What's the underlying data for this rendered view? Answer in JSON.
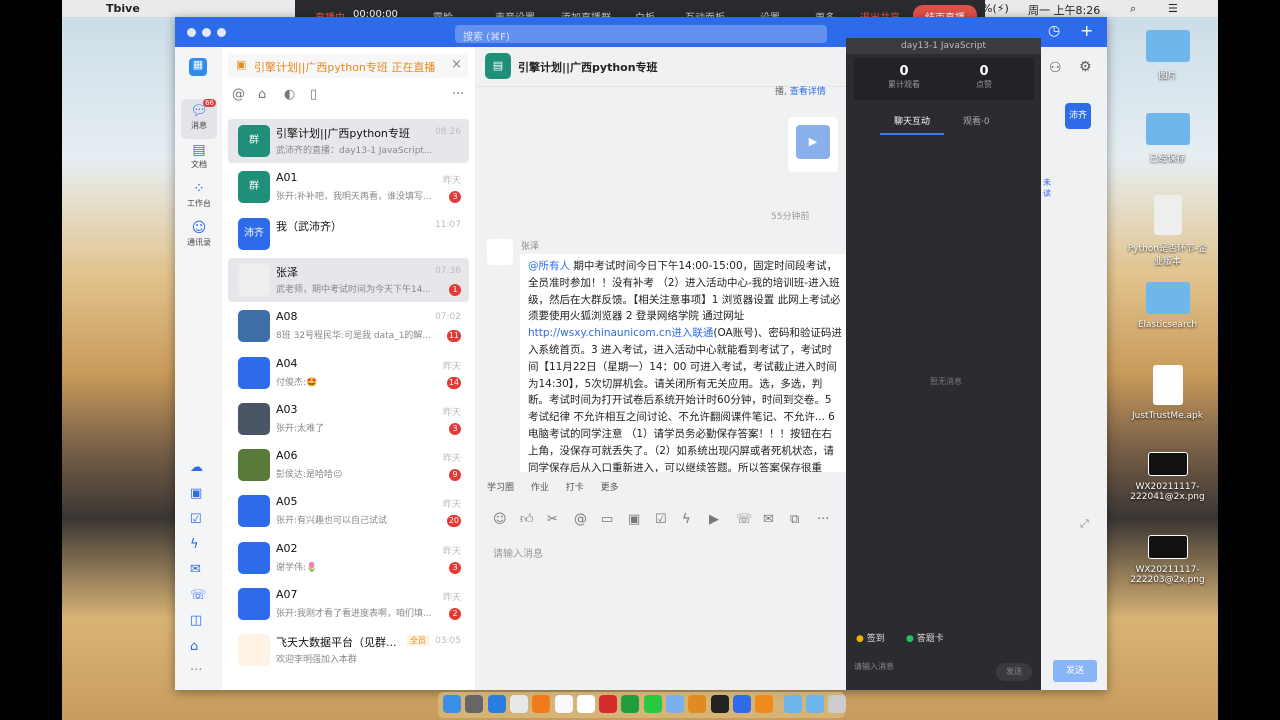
{
  "menubar": {
    "app": "Tbive",
    "status": "%(⚡)",
    "clock": "周一 上午8:26"
  },
  "livebar": {
    "live": "直播中",
    "timer": "00:00:00",
    "items": [
      "露脸",
      "声音设置",
      "添加直播群",
      "白板",
      "互动面板",
      "设置",
      "更多"
    ],
    "stop_share": "退出共享",
    "end_live": "结束直播"
  },
  "window": {
    "search_placeholder": "搜索 (⌘F)"
  },
  "rail": {
    "items": [
      {
        "label": "消息",
        "icon": "chat-icon",
        "badge": "66"
      },
      {
        "label": "文档",
        "icon": "doc-icon"
      },
      {
        "label": "工作台",
        "icon": "workbench-icon"
      },
      {
        "label": "通讯录",
        "icon": "contacts-icon"
      }
    ]
  },
  "banner": {
    "text": "引擎计划||广西python专班 正在直播"
  },
  "conversations": [
    {
      "name": "引擎计划||广西python专班",
      "preview": "武沛齐的直播：day13-1 JavaScript...",
      "time": "08:26",
      "avatar": "群",
      "color": "#1f8f7a",
      "state": "sel"
    },
    {
      "name": "A01",
      "preview": "张开:补补吧，我明天再看，谁没填写...",
      "time": "昨天",
      "badge": "3",
      "avatar": "群",
      "color": "#1f8f7a"
    },
    {
      "name": "我（武沛齐）",
      "preview": "",
      "time": "11:07",
      "avatar": "沛齐",
      "color": "#2e6bea"
    },
    {
      "name": "张泽",
      "preview": "武老师，期中考试时间为今天下午14...",
      "time": "07:36",
      "badge": "1",
      "avatar": "",
      "color": "#eee",
      "state": "hover"
    },
    {
      "name": "A08",
      "preview": "8班 32号程民华:可是我 data_1的解...",
      "time": "07:02",
      "badge": "11",
      "avatar": "",
      "color": "#3d6ea8"
    },
    {
      "name": "A04",
      "preview": "付俊杰:🤩",
      "time": "昨天",
      "badge": "14",
      "avatar": "",
      "color": "#2e6bea"
    },
    {
      "name": "A03",
      "preview": "张开:太难了",
      "time": "昨天",
      "badge": "3",
      "avatar": "",
      "color": "#4a5566"
    },
    {
      "name": "A06",
      "preview": "彭侯达:是哈哈😉",
      "time": "昨天",
      "badge": "9",
      "avatar": "",
      "color": "#5a7a3a"
    },
    {
      "name": "A05",
      "preview": "张开:有兴趣也可以自己试试",
      "time": "昨天",
      "badge": "20",
      "avatar": "",
      "color": "#2e6bea"
    },
    {
      "name": "A02",
      "preview": "谢学伟:🌷",
      "time": "昨天",
      "badge": "3",
      "avatar": "",
      "color": "#2e6bea"
    },
    {
      "name": "A07",
      "preview": "张开:我刚才看了看进度表啊，咱们填...",
      "time": "昨天",
      "badge": "2",
      "avatar": "",
      "color": "#2e6bea"
    },
    {
      "name": "飞天大数据平台（见群...",
      "preview": "欢迎李明强加入本群",
      "time": "03:05",
      "tag": "全员",
      "avatar": "",
      "color": "#fff3e6"
    }
  ],
  "chat": {
    "title": "昨天",
    "header": "引擎计划||广西python专班",
    "notice_prefix": "播,",
    "notice_link": "查看详情",
    "time_divider": "55分钟前",
    "sender": "张泽",
    "mention": "@所有人",
    "message": " 期中考试时间今日下午14:00-15:00，固定时间段考试，全员准时参加！！没有补考 （2）进入活动中心-我的培训班-进入班级，然后在大群反馈。【相关注意事项】1 浏览器设置 此网上考试必须要使用火狐浏览器 2 登录网络学院 通过网址",
    "link": "http://wsxy.chinaunicom.cn进入联通",
    "message2": "(OA账号)、密码和验证码进入系统首页。3 进入考试，进入活动中心就能看到考试了，考试时间【11月22日（星期一）14：00 可进入考试，考试截止进入时间为14:30】，5次切屏机会。请关闭所有无关应用。选，多选，判断。考试时间为打开试卷后系统开始计时60分钟，时间到交卷。5 考试纪律 不允许相互之间讨论、不允许翻阅课件笔记、不允许... 6 电脑考试的同学注意 （1）请学员务必勤保存答案！！！按钮在右上角，没保存可就丢失了。（2）如系统出现闪屏或者死机状态，请同学保存后从入口重新进入，可以继续答题。所以答案保存很重要！！！（3）尽量用滚动条上下拖动找题，否则容易死机。7 手机考试问题 原则上【不建议】...",
    "tabs": [
      "学习圈",
      "作业",
      "打卡",
      "更多"
    ],
    "input_placeholder": "请输入消息",
    "send": "发送",
    "member_label": "沛齐",
    "member_link": "未读"
  },
  "live": {
    "title": "day13-1 JavaScript",
    "stats": [
      {
        "value": "0",
        "label": "累计观看"
      },
      {
        "value": "0",
        "label": "点赞"
      }
    ],
    "tabs": [
      "聊天互动",
      "观看·0"
    ],
    "empty": "暂无消息",
    "signin": "签到",
    "answer_card": "答题卡",
    "input_placeholder": "请输入消息",
    "send": "发送"
  },
  "desktop": {
    "icons": [
      "图片",
      "已经保存",
      "Python是否环节-企业版本",
      "Elasticsearch",
      "JustTrustMe.apk",
      "WX20211117-222041@2x.png",
      "WX20211117-222203@2x.png"
    ]
  }
}
